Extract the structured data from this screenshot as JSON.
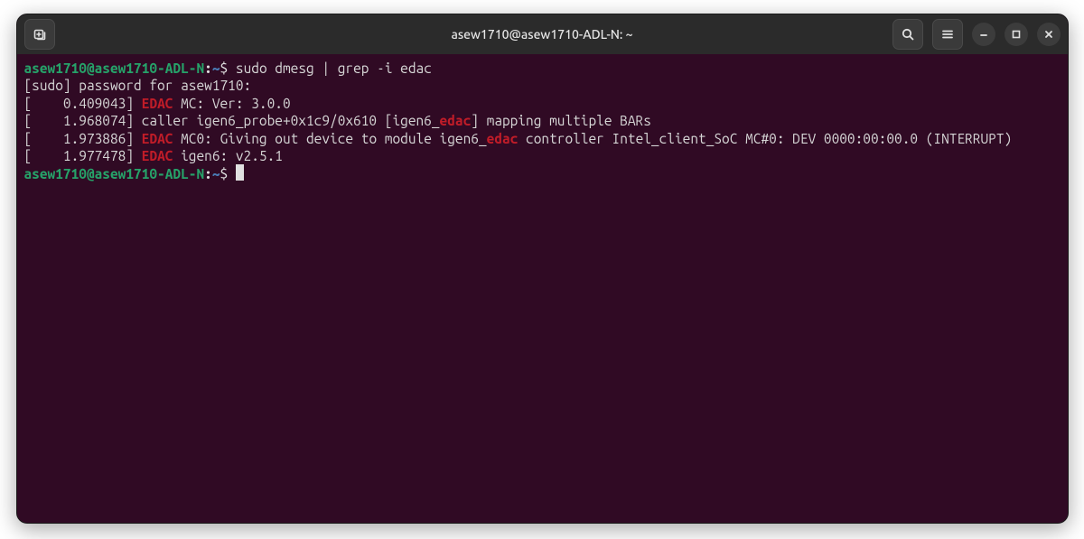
{
  "title": "asew1710@asew1710-ADL-N: ~",
  "prompt": {
    "userhost": "asew1710@asew1710-ADL-N",
    "colon": ":",
    "path": "~",
    "dollar": "$ "
  },
  "lines": {
    "cmd1": "sudo dmesg | grep -i edac",
    "sudo_prompt": "[sudo] password for asew1710:",
    "l1": {
      "pre": "[    0.409043] ",
      "m": "EDAC",
      "post": " MC: Ver: 3.0.0"
    },
    "l2": {
      "pre": "[    1.968074] caller igen6_probe+0x1c9/0x610 [igen6_",
      "m": "edac",
      "post": "] mapping multiple BARs"
    },
    "l3": {
      "pre": "[    1.973886] ",
      "m1": "EDAC",
      "mid": " MC0: Giving out device to module igen6_",
      "m2": "edac",
      "post": " controller Intel_client_SoC MC#0: DEV 0000:00:00.0 (INTERRUPT)"
    },
    "l4": {
      "pre": "[    1.977478] ",
      "m": "EDAC",
      "post": " igen6: v2.5.1"
    }
  }
}
